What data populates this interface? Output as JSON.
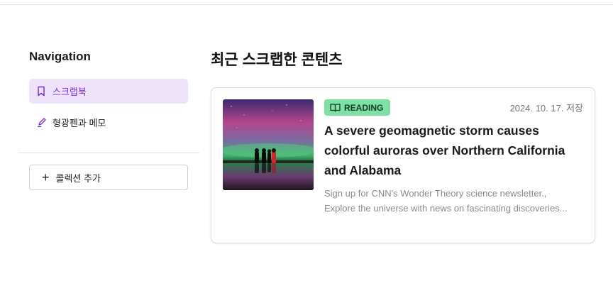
{
  "sidebar": {
    "title": "Navigation",
    "items": [
      {
        "label": "스크랩북",
        "icon": "bookmark-icon",
        "active": true
      },
      {
        "label": "형광펜과 메모",
        "icon": "highlighter-icon",
        "active": false
      }
    ],
    "add_collection_label": "콜렉션 추가"
  },
  "main": {
    "title": "최근 스크랩한 콘텐츠",
    "cards": [
      {
        "badge": "READING",
        "date": "2024. 10. 17. 저장",
        "headline": "A severe geomagnetic storm causes colorful auroras over Northern California and Alabama",
        "description_line1": "Sign up for CNN's Wonder Theory science newsletter.,",
        "description_line2": "Explore the universe with news on fascinating discoveries...",
        "thumbnail": "aurora-photo"
      }
    ]
  },
  "colors": {
    "accent": "#7a2fd1",
    "active_bg": "#efe3fb",
    "badge_bg": "#7ee0a4"
  }
}
